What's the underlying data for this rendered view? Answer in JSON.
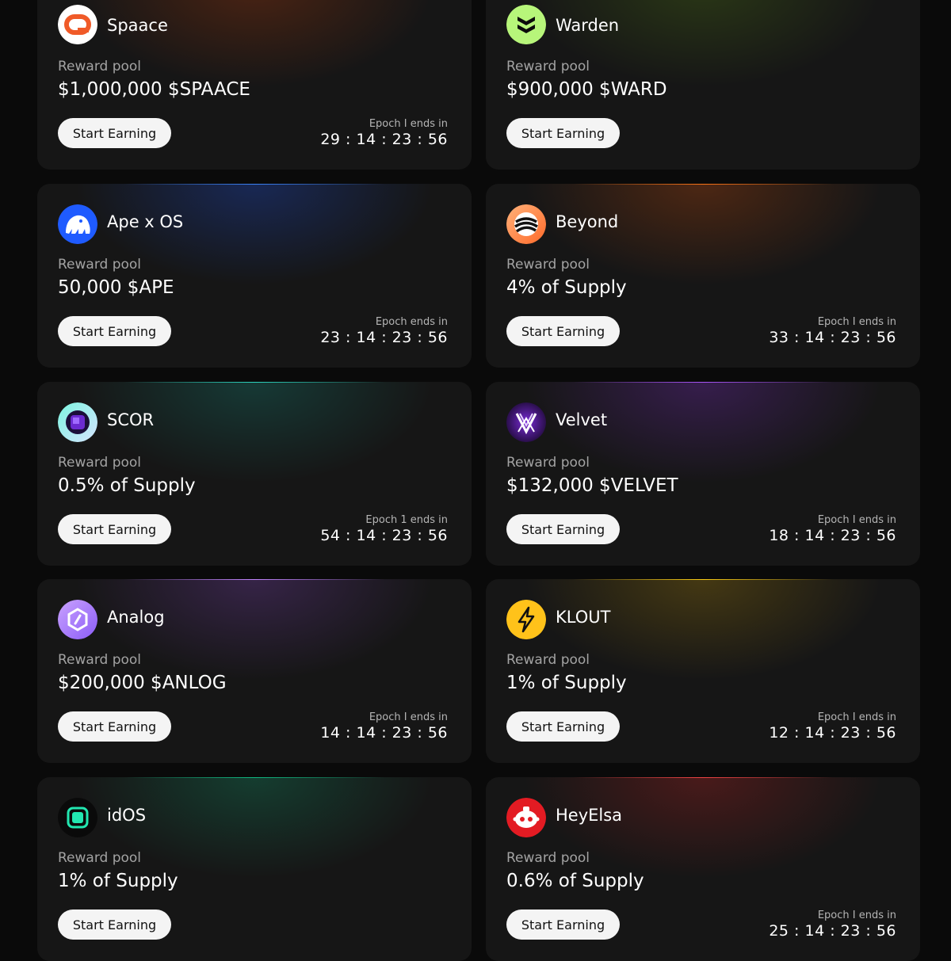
{
  "button_label": "Start Earning",
  "reward_label": "Reward pool",
  "cards": [
    {
      "name": "Spaace",
      "reward": "$1,000,000 $SPAACE",
      "epoch_label": "Epoch I ends in",
      "timer": "29 : 14 : 23 : 56",
      "logo": "spaace-logo-icon",
      "accent": "#c2410c"
    },
    {
      "name": "Warden",
      "reward": "$900,000 $WARD",
      "epoch_label": "",
      "timer": "",
      "logo": "warden-logo-icon",
      "accent": "#a3e635"
    },
    {
      "name": "Ape x OS",
      "reward": "50,000 $APE",
      "epoch_label": "Epoch ends in",
      "timer": "23 : 14 : 23 : 56",
      "logo": "ape-logo-icon",
      "accent": "#1d4ed8"
    },
    {
      "name": "Beyond",
      "reward": "4% of Supply",
      "epoch_label": "Epoch I ends in",
      "timer": "33 : 14 : 23 : 56",
      "logo": "beyond-logo-icon",
      "accent": "#ea580c"
    },
    {
      "name": "SCOR",
      "reward": "0.5% of Supply",
      "epoch_label": "Epoch 1 ends in",
      "timer": "54 : 14 : 23 : 56",
      "logo": "scor-logo-icon",
      "accent": "#14b8a6"
    },
    {
      "name": "Velvet",
      "reward": "$132,000 $VELVET",
      "epoch_label": "Epoch I ends in",
      "timer": "18 : 14 : 23 : 56",
      "logo": "velvet-logo-icon",
      "accent": "#9333ea"
    },
    {
      "name": "Analog",
      "reward": "$200,000 $ANLOG",
      "epoch_label": "Epoch I ends in",
      "timer": "14 : 14 : 23 : 56",
      "logo": "analog-logo-icon",
      "accent": "#a855f7"
    },
    {
      "name": "KLOUT",
      "reward": "1% of Supply",
      "epoch_label": "Epoch I ends in",
      "timer": "12 : 14 : 23 : 56",
      "logo": "klout-logo-icon",
      "accent": "#eab308"
    },
    {
      "name": "idOS",
      "reward": "1% of Supply",
      "epoch_label": "",
      "timer": "",
      "logo": "idos-logo-icon",
      "accent": "#10b981"
    },
    {
      "name": "HeyElsa",
      "reward": "0.6% of Supply",
      "epoch_label": "Epoch I ends in",
      "timer": "25 : 14 : 23 : 56",
      "logo": "heyelsa-logo-icon",
      "accent": "#dc2626"
    }
  ]
}
